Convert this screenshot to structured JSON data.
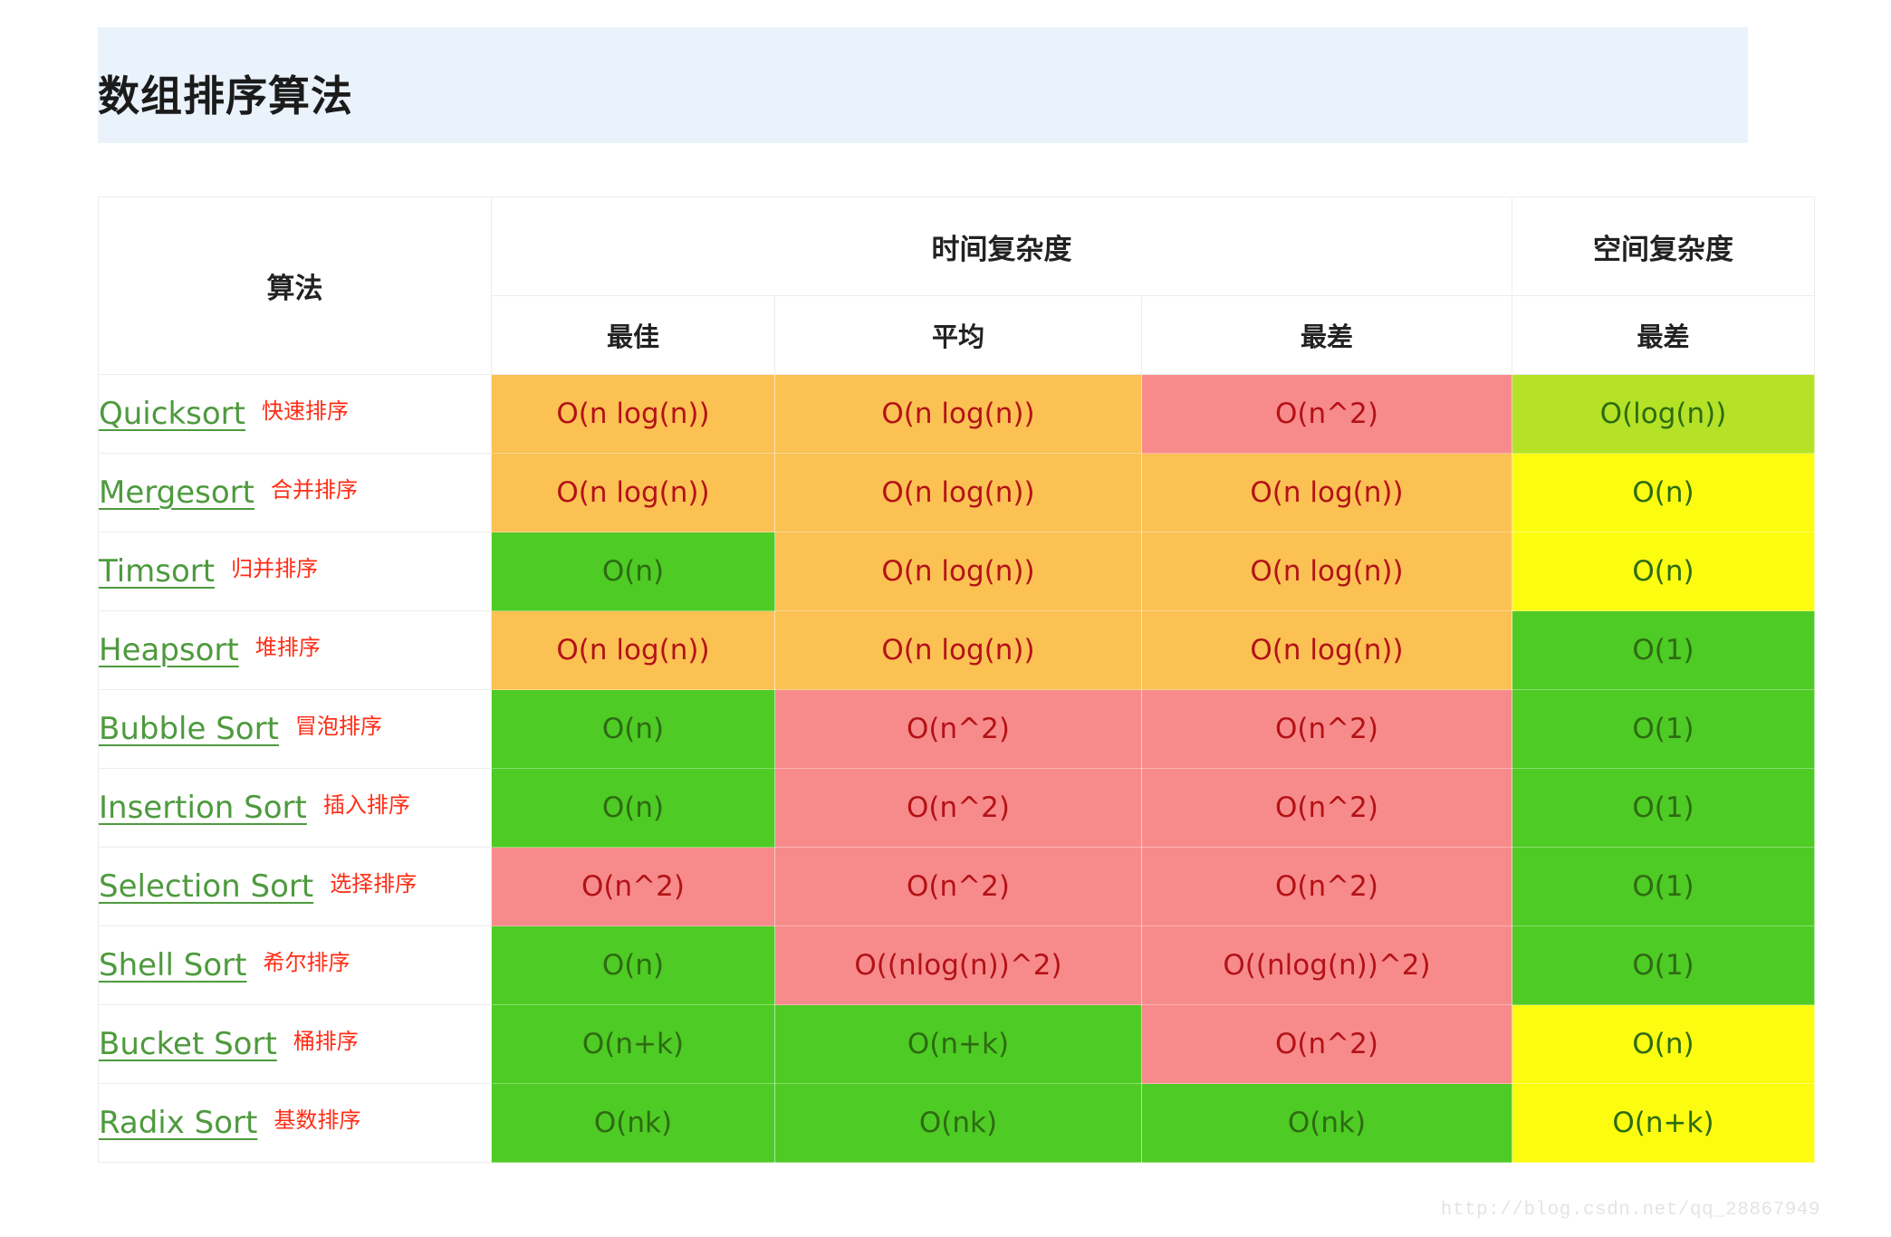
{
  "page": {
    "title": "数组排序算法",
    "watermark": "http://blog.csdn.net/qq_28867949"
  },
  "table": {
    "headers": {
      "algorithm": "算法",
      "time_complexity": "时间复杂度",
      "space_complexity": "空间复杂度",
      "best": "最佳",
      "average": "平均",
      "worst": "最差",
      "space_worst": "最差"
    },
    "colors": {
      "orange": "#fbc153",
      "red": "#f78b8b",
      "green": "#4ecb24",
      "lime": "#b5e226",
      "yellow": "#fcfc11",
      "text_red": "#b31217",
      "text_green": "#2d6b12",
      "link_green": "#4e9a3e",
      "annotation_red": "#ff2d16",
      "banner_blue": "#eaf2fb"
    },
    "rows": [
      {
        "name": "Quicksort",
        "cn": "快速排序",
        "best": {
          "v": "O(n log(n))",
          "bg": "orange",
          "tc": "red"
        },
        "avg": {
          "v": "O(n log(n))",
          "bg": "orange",
          "tc": "red"
        },
        "worst": {
          "v": "O(n^2)",
          "bg": "red",
          "tc": "red"
        },
        "space": {
          "v": "O(log(n))",
          "bg": "lime",
          "tc": "green"
        }
      },
      {
        "name": "Mergesort",
        "cn": "合并排序",
        "best": {
          "v": "O(n log(n))",
          "bg": "orange",
          "tc": "red"
        },
        "avg": {
          "v": "O(n log(n))",
          "bg": "orange",
          "tc": "red"
        },
        "worst": {
          "v": "O(n log(n))",
          "bg": "orange",
          "tc": "red"
        },
        "space": {
          "v": "O(n)",
          "bg": "yellow",
          "tc": "green"
        }
      },
      {
        "name": "Timsort",
        "cn": "归并排序",
        "best": {
          "v": "O(n)",
          "bg": "green",
          "tc": "green"
        },
        "avg": {
          "v": "O(n log(n))",
          "bg": "orange",
          "tc": "red"
        },
        "worst": {
          "v": "O(n log(n))",
          "bg": "orange",
          "tc": "red"
        },
        "space": {
          "v": "O(n)",
          "bg": "yellow",
          "tc": "green"
        }
      },
      {
        "name": "Heapsort",
        "cn": "堆排序",
        "best": {
          "v": "O(n log(n))",
          "bg": "orange",
          "tc": "red"
        },
        "avg": {
          "v": "O(n log(n))",
          "bg": "orange",
          "tc": "red"
        },
        "worst": {
          "v": "O(n log(n))",
          "bg": "orange",
          "tc": "red"
        },
        "space": {
          "v": "O(1)",
          "bg": "green",
          "tc": "green"
        }
      },
      {
        "name": "Bubble Sort",
        "cn": "冒泡排序",
        "best": {
          "v": "O(n)",
          "bg": "green",
          "tc": "green"
        },
        "avg": {
          "v": "O(n^2)",
          "bg": "red",
          "tc": "red"
        },
        "worst": {
          "v": "O(n^2)",
          "bg": "red",
          "tc": "red"
        },
        "space": {
          "v": "O(1)",
          "bg": "green",
          "tc": "green"
        }
      },
      {
        "name": "Insertion Sort",
        "cn": "插入排序",
        "best": {
          "v": "O(n)",
          "bg": "green",
          "tc": "green"
        },
        "avg": {
          "v": "O(n^2)",
          "bg": "red",
          "tc": "red"
        },
        "worst": {
          "v": "O(n^2)",
          "bg": "red",
          "tc": "red"
        },
        "space": {
          "v": "O(1)",
          "bg": "green",
          "tc": "green"
        }
      },
      {
        "name": "Selection Sort",
        "cn": "选择排序",
        "best": {
          "v": "O(n^2)",
          "bg": "red",
          "tc": "red"
        },
        "avg": {
          "v": "O(n^2)",
          "bg": "red",
          "tc": "red"
        },
        "worst": {
          "v": "O(n^2)",
          "bg": "red",
          "tc": "red"
        },
        "space": {
          "v": "O(1)",
          "bg": "green",
          "tc": "green"
        }
      },
      {
        "name": "Shell Sort",
        "cn": "希尔排序",
        "best": {
          "v": "O(n)",
          "bg": "green",
          "tc": "green"
        },
        "avg": {
          "v": "O((nlog(n))^2)",
          "bg": "red",
          "tc": "red"
        },
        "worst": {
          "v": "O((nlog(n))^2)",
          "bg": "red",
          "tc": "red"
        },
        "space": {
          "v": "O(1)",
          "bg": "green",
          "tc": "green"
        }
      },
      {
        "name": "Bucket Sort",
        "cn": "桶排序",
        "best": {
          "v": "O(n+k)",
          "bg": "green",
          "tc": "green"
        },
        "avg": {
          "v": "O(n+k)",
          "bg": "green",
          "tc": "green"
        },
        "worst": {
          "v": "O(n^2)",
          "bg": "red",
          "tc": "red"
        },
        "space": {
          "v": "O(n)",
          "bg": "yellow",
          "tc": "green"
        }
      },
      {
        "name": "Radix Sort",
        "cn": "基数排序",
        "best": {
          "v": "O(nk)",
          "bg": "green",
          "tc": "green"
        },
        "avg": {
          "v": "O(nk)",
          "bg": "green",
          "tc": "green"
        },
        "worst": {
          "v": "O(nk)",
          "bg": "green",
          "tc": "green"
        },
        "space": {
          "v": "O(n+k)",
          "bg": "yellow",
          "tc": "green"
        }
      }
    ]
  }
}
